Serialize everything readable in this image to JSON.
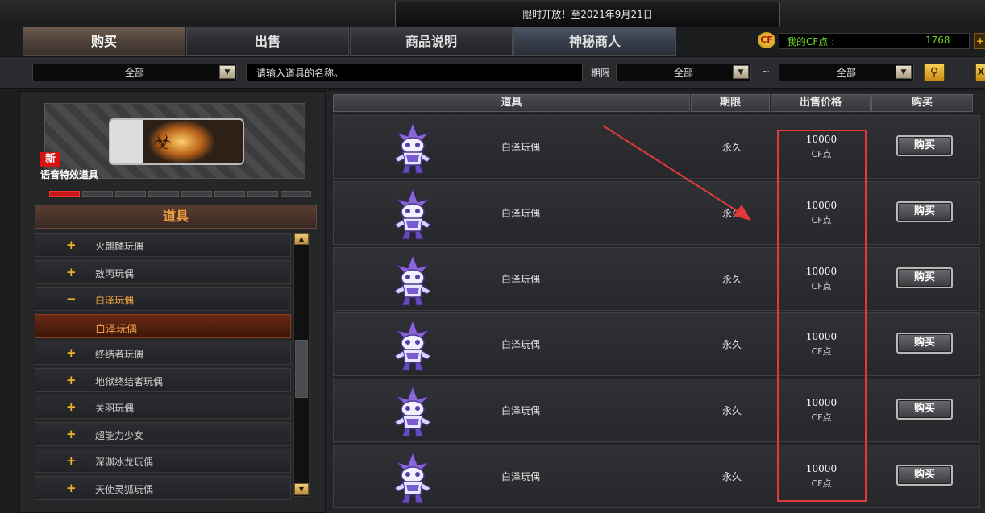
{
  "banner": "限时开放！至2021年9月21日",
  "tabs": [
    {
      "label": "购买"
    },
    {
      "label": "出售"
    },
    {
      "label": "商品说明"
    },
    {
      "label": "神秘商人"
    }
  ],
  "cf": {
    "label": "我的CF点 :",
    "value": "1768",
    "plus": "+"
  },
  "filters": {
    "category": "全部",
    "search_value": "请输入道具的名称。",
    "period_label": "期限",
    "period_from": "全部",
    "tilde": "~",
    "period_to": "全部",
    "close": "X"
  },
  "promo": {
    "badge": "新",
    "title": "语音特效道具"
  },
  "category_header": "道具",
  "categories": [
    {
      "sign": "+",
      "label": "火麒麟玩偶"
    },
    {
      "sign": "+",
      "label": "敖丙玩偶"
    },
    {
      "sign": "−",
      "label": "白泽玩偶"
    },
    {
      "sign": "",
      "label": "白泽玩偶"
    },
    {
      "sign": "+",
      "label": "终结者玩偶"
    },
    {
      "sign": "+",
      "label": "地狱终结者玩偶"
    },
    {
      "sign": "+",
      "label": "关羽玩偶"
    },
    {
      "sign": "+",
      "label": "超能力少女"
    },
    {
      "sign": "+",
      "label": "深渊冰龙玩偶"
    },
    {
      "sign": "+",
      "label": "天使灵狐玩偶"
    }
  ],
  "table": {
    "headers": {
      "item": "道具",
      "period": "期限",
      "price": "出售价格",
      "buy": "购买"
    },
    "rows": [
      {
        "name": "白泽玩偶",
        "period": "永久",
        "price": "10000",
        "unit": "CF点",
        "buy": "购买"
      },
      {
        "name": "白泽玩偶",
        "period": "永久",
        "price": "10000",
        "unit": "CF点",
        "buy": "购买"
      },
      {
        "name": "白泽玩偶",
        "period": "永久",
        "price": "10000",
        "unit": "CF点",
        "buy": "购买"
      },
      {
        "name": "白泽玩偶",
        "period": "永久",
        "price": "10000",
        "unit": "CF点",
        "buy": "购买"
      },
      {
        "name": "白泽玩偶",
        "period": "永久",
        "price": "10000",
        "unit": "CF点",
        "buy": "购买"
      },
      {
        "name": "白泽玩偶",
        "period": "永久",
        "price": "10000",
        "unit": "CF点",
        "buy": "购买"
      }
    ]
  },
  "colors": {
    "accent": "#f0a040",
    "cf_green": "#6fd42a",
    "highlight": "#e03a3a"
  }
}
